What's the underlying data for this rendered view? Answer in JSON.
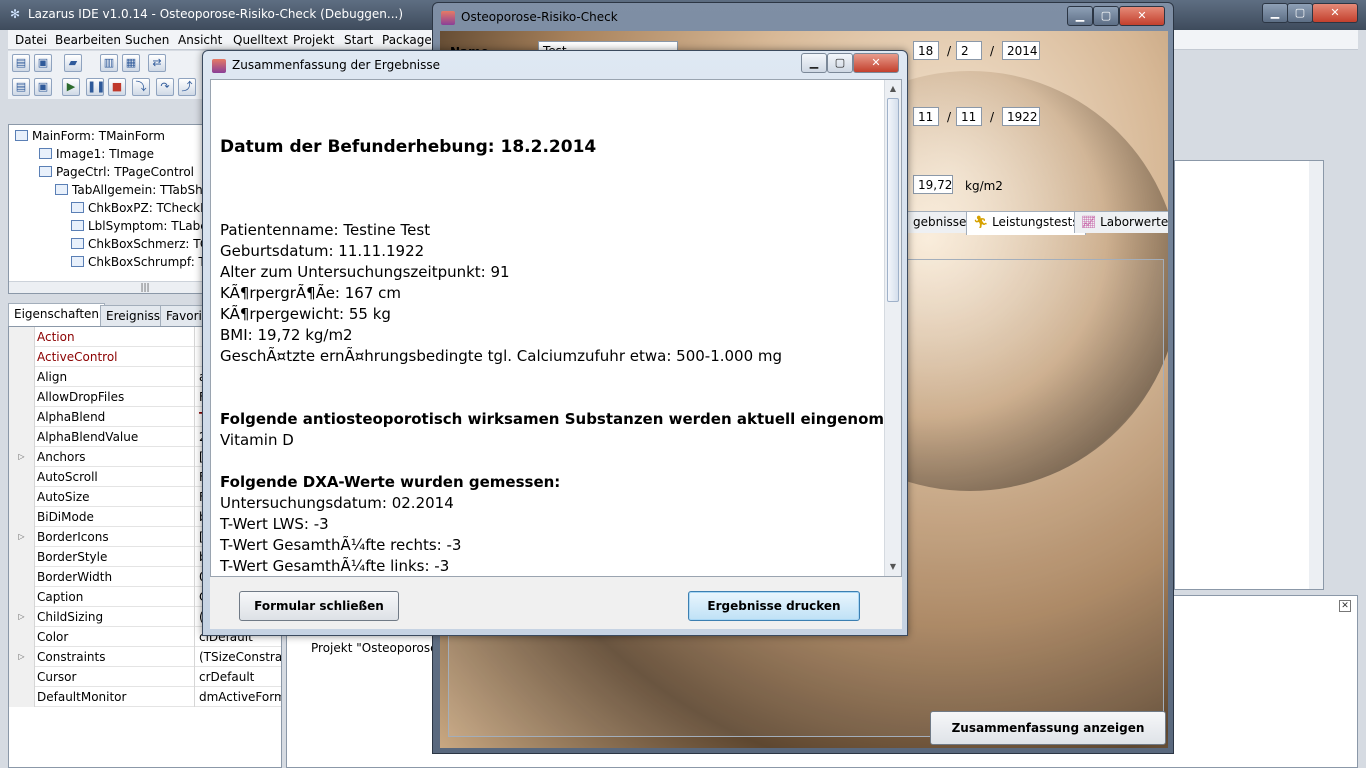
{
  "ide": {
    "title": "Lazarus IDE v1.0.14 - Osteoporose-Risiko-Check (Debuggen...)",
    "menu": [
      "Datei",
      "Bearbeiten",
      "Suchen",
      "Ansicht",
      "Quelltext",
      "Projekt",
      "Start",
      "Package"
    ],
    "tree": [
      {
        "label": "MainForm: TMainForm",
        "level": 0
      },
      {
        "label": "Image1: TImage",
        "level": 1
      },
      {
        "label": "PageCtrl: TPageControl",
        "level": 1
      },
      {
        "label": "TabAllgemein: TTabShee",
        "level": 2
      },
      {
        "label": "ChkBoxPZ: TCheckBo",
        "level": 3
      },
      {
        "label": "LblSymptom: TLabel",
        "level": 3
      },
      {
        "label": "ChkBoxSchmerz: TCh",
        "level": 3
      },
      {
        "label": "ChkBoxSchrumpf: TC",
        "level": 3
      }
    ],
    "tree_scroll_glyph": "|||",
    "inspector_tabs": [
      "Eigenschaften",
      "Ereignisse",
      "Favorit"
    ],
    "properties": [
      {
        "name": "Action",
        "value": "",
        "highlight": true
      },
      {
        "name": "ActiveControl",
        "value": "",
        "highlight": true
      },
      {
        "name": "Align",
        "value": "a"
      },
      {
        "name": "AllowDropFiles",
        "value": "F"
      },
      {
        "name": "AlphaBlend",
        "value": "T"
      },
      {
        "name": "AlphaBlendValue",
        "value": "2"
      },
      {
        "name": "Anchors",
        "value": "[",
        "expandable": true
      },
      {
        "name": "AutoScroll",
        "value": "F"
      },
      {
        "name": "AutoSize",
        "value": "F"
      },
      {
        "name": "BiDiMode",
        "value": "b"
      },
      {
        "name": "BorderIcons",
        "value": "[",
        "expandable": true
      },
      {
        "name": "BorderStyle",
        "value": "b"
      },
      {
        "name": "BorderWidth",
        "value": "0"
      },
      {
        "name": "Caption",
        "value": "C"
      },
      {
        "name": "ChildSizing",
        "value": "(",
        "expandable": true
      },
      {
        "name": "Color",
        "value": "clDefault"
      },
      {
        "name": "Constraints",
        "value": "(TSizeConstraint",
        "expandable": true
      },
      {
        "name": "Cursor",
        "value": "crDefault"
      },
      {
        "name": "DefaultMonitor",
        "value": "dmActiveForm"
      }
    ],
    "message": "Projekt \"Osteoporose-R"
  },
  "form": {
    "title": "Osteoporose-Risiko-Check",
    "label_name": "Name",
    "name_value": "Test",
    "date_exam": {
      "day": "18",
      "month": "2",
      "year": "2014"
    },
    "date_birth": {
      "day": "11",
      "month": "11",
      "year": "1922"
    },
    "bmi_value": "19,72",
    "bmi_unit": "kg/m2",
    "tabs": [
      "gebnisse",
      "Leistungstests",
      "Laborwerte"
    ],
    "summary_button": "Zusammenfassung anzeigen"
  },
  "dialog": {
    "title": "Zusammenfassung der Ergebnisse",
    "report_title": "Datum der Befunderhebung: 18.2.2014",
    "patient_lines": [
      "Patientenname: Testine Test",
      "Geburtsdatum: 11.11.1922",
      "Alter zum Untersuchungszeitpunkt: 91",
      "KÃ¶rpergrÃ¶Ãe: 167 cm",
      "KÃ¶rpergewicht: 55 kg",
      "BMI: 19,72 kg/m2",
      "GeschÃ¤tzte ernÃ¤hrungsbedingte tgl. Calciumzufuhr etwa: 500-1.000 mg"
    ],
    "substances_heading": "Folgende antiosteoporotisch wirksamen Substanzen werden aktuell eingenommen:",
    "substances": [
      "Vitamin D"
    ],
    "dxa_heading": "Folgende DXA-Werte wurden gemessen:",
    "dxa_lines": [
      "Untersuchungsdatum: 02.2014",
      "T-Wert LWS: -3",
      "T-Wert GesamthÃ¼fte rechts: -3",
      "T-Wert GesamthÃ¼fte links: -3"
    ],
    "close_button": "Formular schließen",
    "print_button": "Ergebnisse drucken"
  }
}
